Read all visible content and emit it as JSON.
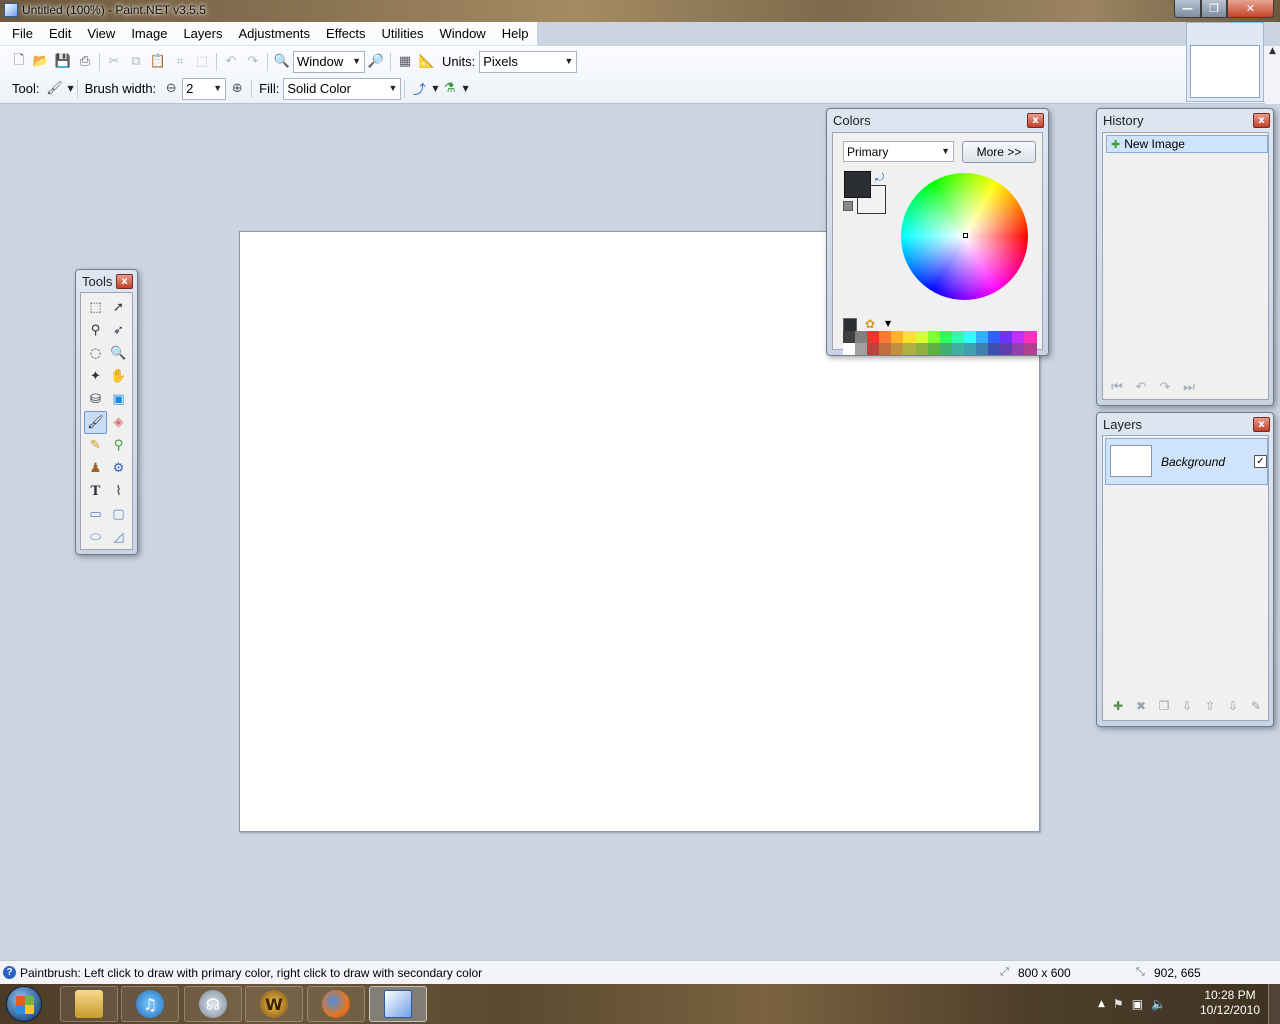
{
  "window": {
    "title": "Untitled (100%) - Paint.NET v3.5.5",
    "min_glyph": "—",
    "max_glyph": "❐",
    "close_glyph": "✕"
  },
  "menu": [
    "File",
    "Edit",
    "View",
    "Image",
    "Layers",
    "Adjustments",
    "Effects",
    "Utilities",
    "Window",
    "Help"
  ],
  "toolbar": {
    "zoom_value": "Window",
    "units_label": "Units:",
    "units_value": "Pixels",
    "tool_label": "Tool:",
    "brush_width_label": "Brush width:",
    "brush_width_value": "2",
    "fill_label": "Fill:",
    "fill_value": "Solid Color",
    "minus_glyph": "⊖",
    "plus_glyph": "⊕",
    "dropdown_glyph": "▼"
  },
  "tools_window": {
    "title": "Tools",
    "close_glyph": "x"
  },
  "colors_window": {
    "title": "Colors",
    "close_glyph": "x",
    "mode_value": "Primary",
    "more_label": "More >>",
    "primary_color": "#2b2e33",
    "secondary_color": "#f2f2f2",
    "palette_top": [
      "#404040",
      "#808080",
      "#ff3030",
      "#ff7a30",
      "#ffb030",
      "#ffe030",
      "#d8ff30",
      "#80ff30",
      "#30ff60",
      "#30ffb0",
      "#30ffff",
      "#30b0ff",
      "#3060ff",
      "#7030ff",
      "#c030ff",
      "#ff30c0"
    ],
    "palette_bottom": [
      "#ffffff",
      "#a0a0a0",
      "#c04040",
      "#c07040",
      "#c09040",
      "#b0b040",
      "#90b040",
      "#60b040",
      "#40b070",
      "#40b0a0",
      "#40a0b0",
      "#4080b0",
      "#4050b0",
      "#6040b0",
      "#9040b0",
      "#b04090"
    ]
  },
  "history_window": {
    "title": "History",
    "close_glyph": "x",
    "items": [
      "New Image"
    ]
  },
  "layers_window": {
    "title": "Layers",
    "close_glyph": "x",
    "layers": [
      {
        "name": "Background",
        "visible_glyph": "✓"
      }
    ]
  },
  "status": {
    "help_glyph": "?",
    "text": "Paintbrush: Left click to draw with primary color, right click to draw with secondary color",
    "image_size": "800 x 600",
    "cursor_pos": "902, 665"
  },
  "taskbar": {
    "time": "10:28 PM",
    "date": "10/12/2010",
    "wow_glyph": "W",
    "tray_up_glyph": "▲",
    "flag_glyph": "⚑",
    "network_glyph": "▣",
    "volume_glyph": "🔈"
  }
}
